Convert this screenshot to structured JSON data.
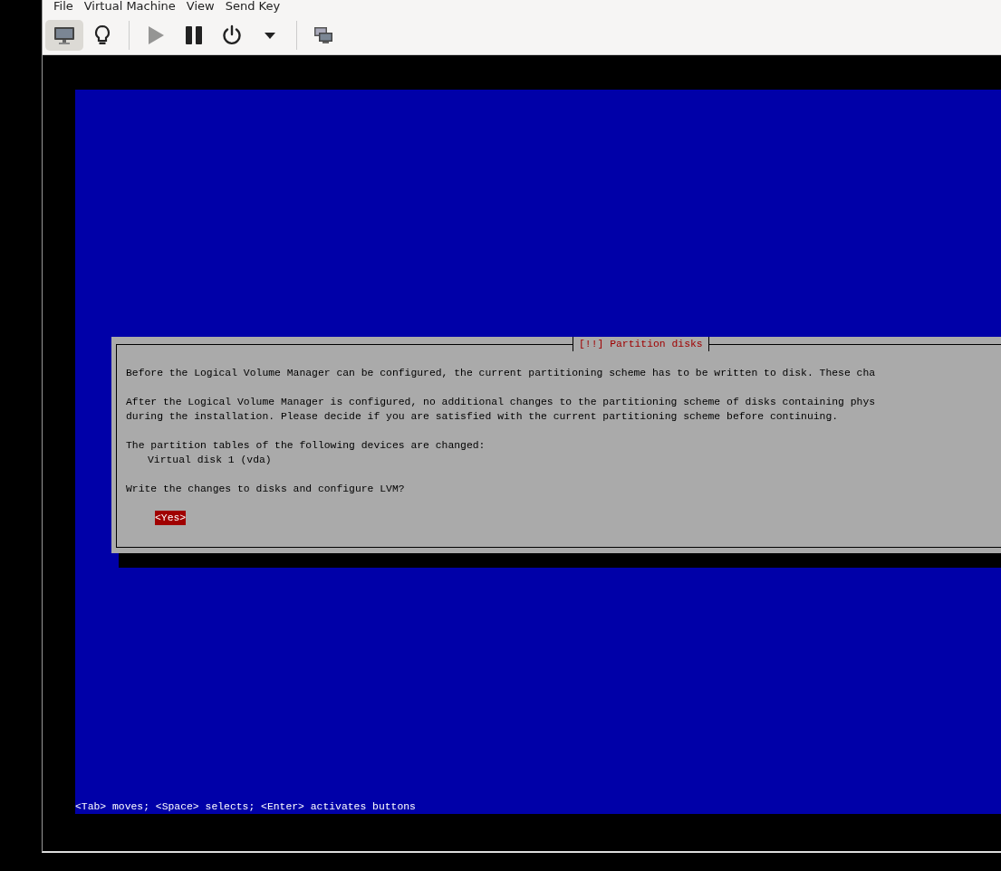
{
  "menu": [
    "File",
    "Virtual Machine",
    "View",
    "Send Key"
  ],
  "toolbar": [
    {
      "kind": "console",
      "selected": true,
      "disabled": false
    },
    {
      "kind": "details",
      "selected": false,
      "disabled": false
    },
    {
      "kind": "separator"
    },
    {
      "kind": "run",
      "selected": false,
      "disabled": true
    },
    {
      "kind": "pause",
      "selected": false,
      "disabled": false
    },
    {
      "kind": "shutdown",
      "selected": false,
      "disabled": false
    },
    {
      "kind": "menu",
      "selected": false,
      "disabled": false
    },
    {
      "kind": "separator"
    },
    {
      "kind": "snapshots",
      "selected": false,
      "disabled": false
    }
  ],
  "dialog": {
    "title": "[!!] Partition disks",
    "blocks": [
      {
        "lines": [
          "Before the Logical Volume Manager can be configured, the current partitioning scheme has to be written to disk. These cha"
        ]
      },
      {
        "lines": [
          "After the Logical Volume Manager is configured, no additional changes to the partitioning scheme of disks containing phys",
          "during the installation. Please decide if you are satisfied with the current partitioning scheme before continuing."
        ]
      },
      {
        "lines": [
          "The partition tables of the following devices are changed:"
        ],
        "items": [
          "Virtual disk 1 (vda)"
        ]
      },
      {
        "lines": [
          "Write the changes to disks and configure LVM?"
        ]
      }
    ],
    "buttons": [
      {
        "label": "<Yes>",
        "selected": true
      }
    ]
  },
  "help_line": "<Tab> moves; <Space> selects; <Enter> activates buttons"
}
